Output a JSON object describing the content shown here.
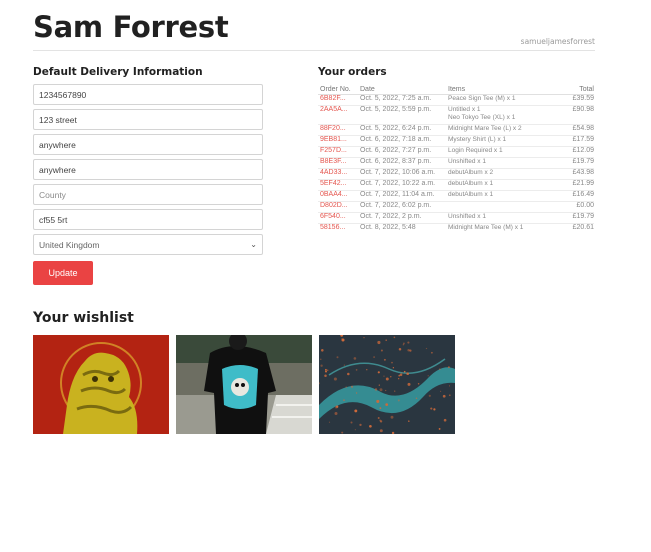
{
  "profile": {
    "name": "Sam Forrest",
    "username": "samueljamesforrest"
  },
  "delivery": {
    "heading": "Default Delivery Information",
    "fields": [
      {
        "value": "1234567890",
        "placeholder": ""
      },
      {
        "value": "123 street",
        "placeholder": ""
      },
      {
        "value": "anywhere",
        "placeholder": ""
      },
      {
        "value": "anywhere",
        "placeholder": ""
      },
      {
        "value": "",
        "placeholder": "County"
      },
      {
        "value": "cf55 5rt",
        "placeholder": ""
      }
    ],
    "country": "United Kingdom",
    "update_label": "Update"
  },
  "orders": {
    "heading": "Your orders",
    "columns": [
      "Order No.",
      "Date",
      "Items",
      "Total"
    ],
    "rows": [
      {
        "id": "6B82F...",
        "date": "Oct. 5, 2022, 7:25 a.m.",
        "items": "Peace Sign Tee (M) x 1",
        "total": "£39.59"
      },
      {
        "id": "2AA5A...",
        "date": "Oct. 5, 2022, 5:59 p.m.",
        "items": "Untitled x 1\nNeo Tokyo Tee (XL) x 1",
        "total": "£90.98"
      },
      {
        "id": "88F20...",
        "date": "Oct. 5, 2022, 6:24 p.m.",
        "items": "Midnight Mare Tee (L) x 2",
        "total": "£54.98"
      },
      {
        "id": "9EB81...",
        "date": "Oct. 6, 2022, 7:18 a.m.",
        "items": "Mystery Shirt (L) x 1",
        "total": "£17.59"
      },
      {
        "id": "F257D...",
        "date": "Oct. 6, 2022, 7:27 p.m.",
        "items": "Login Required x 1",
        "total": "£12.09"
      },
      {
        "id": "B8E3F...",
        "date": "Oct. 6, 2022, 8:37 p.m.",
        "items": "Unshifted x 1",
        "total": "£19.79"
      },
      {
        "id": "4AD33...",
        "date": "Oct. 7, 2022, 10:06 a.m.",
        "items": "debutAlbum x 2",
        "total": "£43.98"
      },
      {
        "id": "5EF42...",
        "date": "Oct. 7, 2022, 10:22 a.m.",
        "items": "debutAlbum x 1",
        "total": "£21.99"
      },
      {
        "id": "0BAA4...",
        "date": "Oct. 7, 2022, 11:04 a.m.",
        "items": "debutAlbum x 1",
        "total": "£16.49"
      },
      {
        "id": "D802D...",
        "date": "Oct. 7, 2022, 6:02 p.m.",
        "items": "",
        "total": "£0.00"
      },
      {
        "id": "6F540...",
        "date": "Oct. 7, 2022, 2 p.m.",
        "items": "Unshifted x 1",
        "total": "£19.79"
      },
      {
        "id": "58156...",
        "date": "Oct. 8, 2022, 5:48",
        "items": "Midnight Mare Tee (M) x 1",
        "total": "£20.61"
      }
    ]
  },
  "wishlist": {
    "heading": "Your wishlist",
    "items": [
      {
        "image": "golden-statue-artwork",
        "bg": "#b32312",
        "accent": "#c9b21f"
      },
      {
        "image": "midnight-mare-tee-photo",
        "bg": "#6d6e62",
        "accent": "#3fbcc8"
      },
      {
        "image": "teal-particle-artwork",
        "bg": "#2a3640",
        "accent": "#3aa9ad"
      }
    ]
  }
}
